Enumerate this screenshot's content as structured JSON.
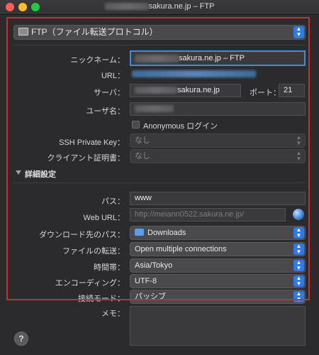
{
  "window": {
    "title_suffix": "sakura.ne.jp – FTP"
  },
  "protocol": {
    "label": "FTP（ファイル転送プロトコル）",
    "icon": "ftp-drive-icon"
  },
  "fields": {
    "nickname": {
      "label": "ニックネーム：",
      "value": "sakura.ne.jp – FTP"
    },
    "url": {
      "label": "URL："
    },
    "server": {
      "label": "サーバ：",
      "value": "sakura.ne.jp"
    },
    "port": {
      "label": "ポート：",
      "value": "21"
    },
    "username": {
      "label": "ユーザ名："
    },
    "anonymous": {
      "label": "Anonymous ログイン",
      "checked": false
    },
    "ssh_key": {
      "label": "SSH Private Key：",
      "value": "なし"
    },
    "client_cert": {
      "label": "クライアント証明書：",
      "value": "なし"
    }
  },
  "advanced": {
    "label": "詳細設定",
    "expanded": true
  },
  "advanced_fields": {
    "path": {
      "label": "パス：",
      "value": "www"
    },
    "web_url": {
      "label": "Web URL：",
      "placeholder": "http://meiann0522.sakura.ne.jp/"
    },
    "download_path": {
      "label": "ダウンロード先のパス：",
      "value": "Downloads"
    },
    "transfer": {
      "label": "ファイルの転送：",
      "value": "Open multiple connections"
    },
    "timezone": {
      "label": "時間帯：",
      "value": "Asia/Tokyo"
    },
    "encoding": {
      "label": "エンコーディング：",
      "value": "UTF-8"
    },
    "connect_mode": {
      "label": "接続モード：",
      "value": "パッシブ"
    },
    "notes": {
      "label": "メモ：",
      "value": ""
    }
  },
  "help": {
    "label": "?"
  },
  "colors": {
    "accent": "#2f7ae5",
    "highlight_border": "#d42a2a",
    "focus_ring": "#3b8ee6"
  }
}
